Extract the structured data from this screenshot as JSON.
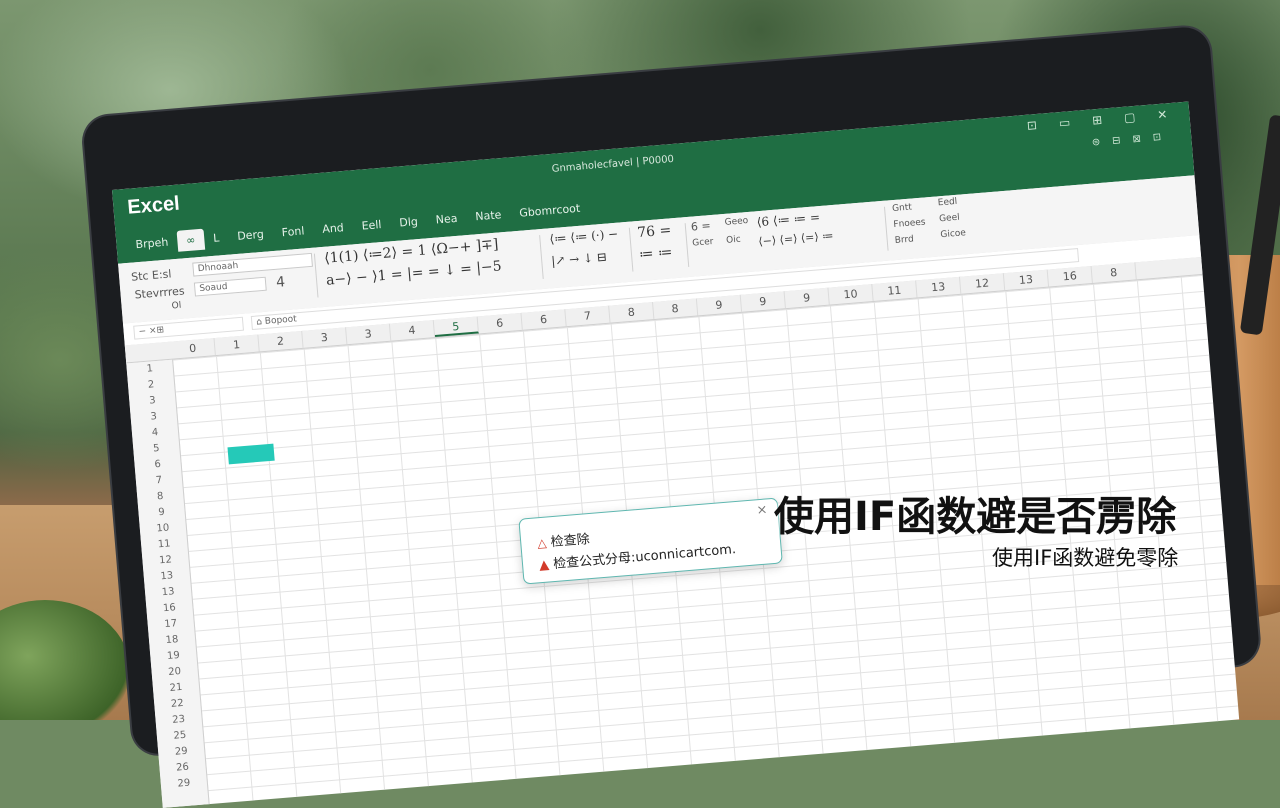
{
  "app": {
    "name": "Excel",
    "doc_title": "Gnmaholecfavel | P0000"
  },
  "window_controls": [
    "⊡",
    "▭",
    "⊞",
    "▢",
    "✕"
  ],
  "window_controls_row2": [
    "⊜",
    "⊟",
    "⊠",
    "⊡"
  ],
  "tabs": [
    "Brpeh",
    "∞",
    "L",
    "Derg",
    "Fonl",
    "And",
    "Eell",
    "Dlg",
    "Nea",
    "Nate",
    "Gbomrcoot"
  ],
  "ribbon": {
    "left_labels": [
      "Stc E:sl",
      "Stevrrres",
      "Ol"
    ],
    "input1": "Dhnoaah",
    "input2": "Soaud",
    "size_value": "4",
    "formula_top": "⟨1(1)  ⟨≔2⟩ = 1 ⟨Ω−+ ]∓]",
    "formula_bottom": "a−⟩ − ⟩1 = |= = ↓ = |−5",
    "formula_mid_top": "⟨≔ ⟨≔ (·) −",
    "formula_mid_bottom": "|↗ → ↓ ⊟",
    "numbers_top": "76 =",
    "numbers_bottom": "≔ ≔",
    "style_labels": [
      "6 =",
      "Gcer",
      "Geeo",
      "Oic"
    ],
    "func_top": "⟨6 ⟨≔ ≔ =",
    "func_mid": "⟨−⟩ ⟨=⟩ ⟨=⟩ ≔",
    "right_labels": [
      "Gntt",
      "Fnoees",
      "Brrd"
    ],
    "far_right": [
      "Eedl",
      "Geel",
      "Gicoe"
    ]
  },
  "formula_bar": {
    "name_box": "− ×⊞",
    "text": "⌂ Bopoot"
  },
  "columns": [
    "0",
    "1",
    "2",
    "3",
    "3",
    "4",
    "5",
    "6",
    "6",
    "7",
    "8",
    "8",
    "9",
    "9",
    "9",
    "10",
    "11",
    "13",
    "12",
    "13",
    "16",
    "8"
  ],
  "selected_column_index": 6,
  "corner_label": "1",
  "rows": [
    "1",
    "2",
    "3",
    "3",
    "4",
    "5",
    "6",
    "7",
    "8",
    "9",
    "10",
    "11",
    "12",
    "13",
    "13",
    "16",
    "17",
    "18",
    "19",
    "20",
    "21",
    "22",
    "23",
    "25",
    "29",
    "26",
    "29"
  ],
  "dialog": {
    "line1": "检查除",
    "line2": "检查公式分母:uconnicartcom.",
    "close": "×"
  },
  "caption": {
    "main": "使用IF函数避是否雳除",
    "sub": "使用IF函数避免零除"
  }
}
